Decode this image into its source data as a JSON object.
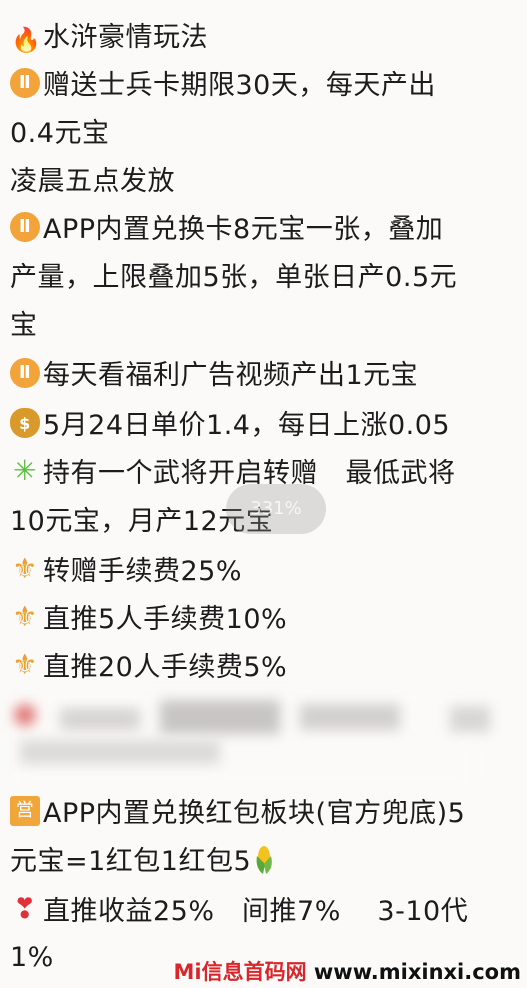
{
  "lines": {
    "l1": "水浒豪情玩法",
    "l2": "赠送士兵卡期限30天，每天产出",
    "l3": "0.4元宝",
    "l4": "凌晨五点发放",
    "l5": "APP内置兑换卡8元宝一张，叠加",
    "l6": "产量，上限叠加5张，单张日产0.5元",
    "l7": "宝",
    "l8": "每天看福利广告视频产出1元宝",
    "l9": "5月24日单价1.4，每日上涨0.05",
    "l10": "持有一个武将开启转赠　最低武将",
    "l11": "10元宝，月产12元宝",
    "l12": "转赠手续费25%",
    "l13": "直推5人手续费10%",
    "l14": "直推20人手续费5%",
    "l15": "APP内置兑换红包板块(官方兜底)5",
    "l16": "元宝=1红包1红包5",
    "l17": "直推收益25%　间推7%　 3-10代",
    "l18": "1%"
  },
  "overlay": {
    "progress_text": "331%"
  },
  "watermark": {
    "brand": "Mi信息首码网",
    "url": "www.mixinxi.com"
  },
  "icons": [
    "fire-icon",
    "gemini-icon",
    "moneybag-icon",
    "sparkle-icon",
    "fleur-de-lis-icon",
    "ying-badge-icon",
    "heart-icon",
    "corn-icon"
  ]
}
